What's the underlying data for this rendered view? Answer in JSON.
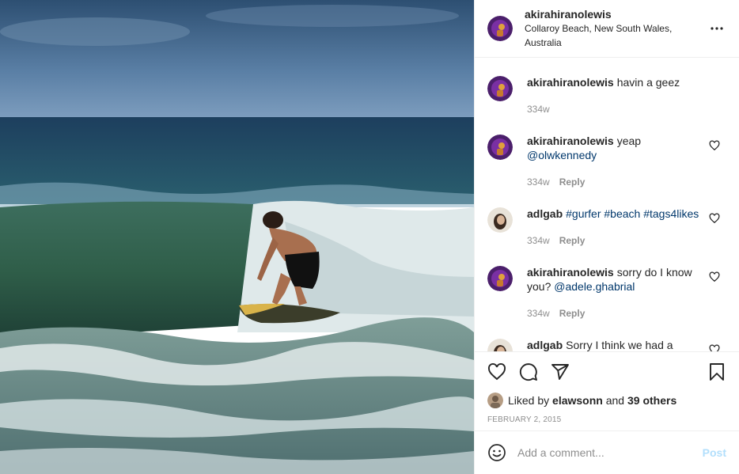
{
  "post": {
    "author": "akirahiranolewis",
    "location": "Collaroy Beach, New South Wales, Australia",
    "more_icon": "more-horizontal-icon",
    "colors": {
      "link": "#00376b",
      "meta": "#8e8e8e",
      "post_disabled": "#b2dffc"
    }
  },
  "comments": [
    {
      "user": "akirahiranolewis",
      "text": "havin a geez",
      "mention": "",
      "time": "334w",
      "reply": ""
    },
    {
      "user": "akirahiranolewis",
      "text": "yeap",
      "mention": "@olwkennedy",
      "time": "334w",
      "reply": "Reply"
    },
    {
      "user": "adlgab",
      "text": "",
      "mention": "#gurfer #beach #tags4likes",
      "time": "334w",
      "reply": "Reply"
    },
    {
      "user": "akirahiranolewis",
      "text": "sorry do I know you?",
      "mention": "@adele.ghabrial",
      "time": "334w",
      "reply": "Reply"
    },
    {
      "user": "adlgab",
      "text": "Sorry I think we had a",
      "mention": "",
      "time": "",
      "reply": ""
    }
  ],
  "actions": {
    "like_icon": "heart-icon",
    "comment_icon": "comment-icon",
    "share_icon": "paper-plane-icon",
    "save_icon": "bookmark-icon"
  },
  "likes": {
    "prefix": "Liked by",
    "user": "elawsonn",
    "joiner": "and",
    "others": "39 others"
  },
  "date": "FEBRUARY 2, 2015",
  "add_comment": {
    "placeholder": "Add a comment...",
    "post_label": "Post",
    "emoji_icon": "smiley-icon"
  }
}
